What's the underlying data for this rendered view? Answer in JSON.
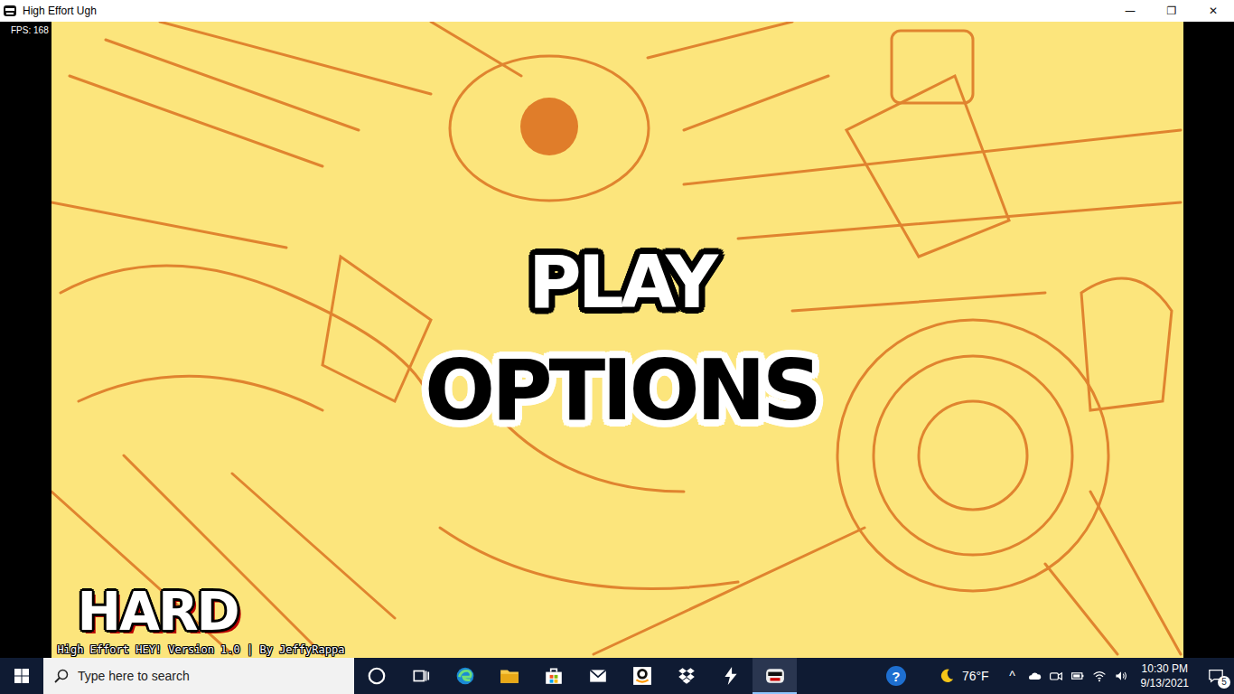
{
  "window": {
    "title": "High Effort Ugh",
    "controls": [
      "—",
      "❐",
      "✕"
    ]
  },
  "game": {
    "fps": "FPS: 168",
    "menu": [
      {
        "label": "PLAY",
        "selected": false
      },
      {
        "label": "OPTIONS",
        "selected": true
      }
    ],
    "difficulty": "HARD",
    "version": "High Effort HEY! Version 1.0 | By JeffyRappa"
  },
  "taskbar": {
    "search_placeholder": "Type here to search",
    "apps": [
      {
        "kind": "cortana",
        "active": false
      },
      {
        "kind": "taskview",
        "active": false
      },
      {
        "kind": "edge",
        "active": false
      },
      {
        "kind": "explorer",
        "active": false
      },
      {
        "kind": "store",
        "active": false
      },
      {
        "kind": "mail",
        "active": false
      },
      {
        "kind": "amazon",
        "active": false
      },
      {
        "kind": "dropbox",
        "active": false
      },
      {
        "kind": "bolt",
        "active": false
      },
      {
        "kind": "game",
        "active": true
      }
    ],
    "help": "?",
    "weather": {
      "temp": "76°F"
    },
    "chevron": "^",
    "tray": [
      {
        "kind": "cloud"
      },
      {
        "kind": "meet"
      },
      {
        "kind": "battery"
      },
      {
        "kind": "wifi"
      },
      {
        "kind": "volume"
      }
    ],
    "clock": {
      "time": "10:30 PM",
      "date": "9/13/2021"
    },
    "notifications": "5"
  }
}
